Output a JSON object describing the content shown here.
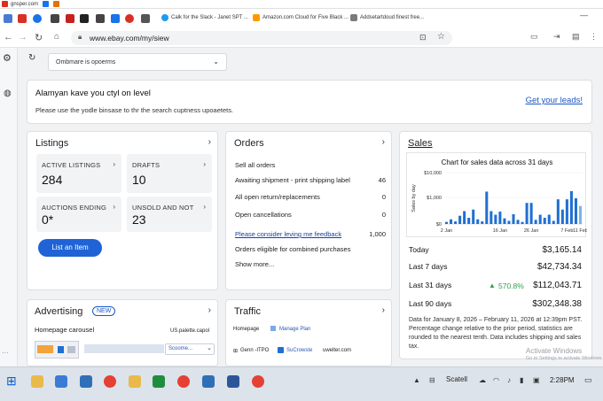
{
  "browser": {
    "bookmarks": [
      {
        "label": "gnsper.com",
        "color": "#d93025"
      },
      {
        "label": "",
        "color": "#1a73e8"
      },
      {
        "label": "",
        "color": "#e37400"
      }
    ],
    "tabs": [
      {
        "label": "Calk for the Slack - Janet SPT ...",
        "color": "#1d9bf0"
      },
      {
        "label": "Amazon.com Cloud for Five Black ...",
        "color": "#ff9900"
      },
      {
        "label": "Addsetartdoud finest free...",
        "color": "#7b7b7b"
      }
    ],
    "url": "www.ebay.com/my/siew"
  },
  "filter": {
    "selected": "Ombmare is opoerms"
  },
  "alert": {
    "title": "Alamyan kave you ctyl on level",
    "body": "Please use the yodle binsase to thr the search cuptness upoaetets.",
    "link": "Get your leads!"
  },
  "listings": {
    "title": "Listings",
    "tiles": [
      {
        "label": "ACTIVE LISTINGS",
        "value": "284"
      },
      {
        "label": "DRAFTS",
        "value": "10"
      },
      {
        "label": "AUCTIONS ENDING",
        "value": "0*"
      },
      {
        "label": "UNSOLD AND NOT",
        "value": "23"
      }
    ],
    "button": "List an Item"
  },
  "orders": {
    "title": "Orders",
    "rows": [
      {
        "label": "Sell all orders",
        "count": ""
      },
      {
        "label": "Awaiting shipment - print shipping label",
        "count": "46"
      },
      {
        "label": "All open return/replacements",
        "count": "0"
      },
      {
        "label": "Open cancellations",
        "count": "0"
      },
      {
        "label": "Please consider leving me feedback",
        "count": "1,000"
      },
      {
        "label": "Orders eligible for combined purchases",
        "count": ""
      }
    ],
    "show_more": "Show more..."
  },
  "sales": {
    "title": "Sales",
    "rows": [
      {
        "label": "Today",
        "value": "$3,165.14",
        "change": ""
      },
      {
        "label": "Last 7 days",
        "value": "$42,734.34",
        "change": ""
      },
      {
        "label": "Last 31 days",
        "value": "$112,043.71",
        "change": "570.8%"
      },
      {
        "label": "Last 90 days",
        "value": "$302,348.38",
        "change": ""
      }
    ],
    "footnote": "Data for January 8, 2026 – February 11, 2026 at 12:39pm PST. Percentage change relative to the prior period, statistics are rounded to the nearest tenth. Data includes shipping and sales tax.",
    "colors": {
      "bar": "#1f6fd1",
      "bar_light": "#7fb1ec",
      "up": "#2e9e4f"
    }
  },
  "chart_data": {
    "type": "bar",
    "title": "Chart for sales data across 31 days",
    "ylabel": "Sales by day",
    "ylim": [
      0,
      10000
    ],
    "yticks": [
      "$0",
      "$1,000",
      "$10,000"
    ],
    "xticks": [
      "2 Jan",
      "16 Jan",
      "26 Jan",
      "7 Feb",
      "11 Feb"
    ],
    "values": [
      400,
      900,
      500,
      1600,
      2500,
      1200,
      2800,
      900,
      500,
      6300,
      2500,
      1800,
      2400,
      1100,
      600,
      1900,
      800,
      400,
      4100,
      4100,
      800,
      1800,
      1200,
      1800,
      600,
      4800,
      2800,
      4800,
      6400,
      5000,
      3500
    ]
  },
  "advertising": {
    "title": "Advertising",
    "badge": "NEW",
    "sub": "Homepage carousel",
    "tag": "US.palette.capol",
    "select": "Scoome..."
  },
  "traffic": {
    "title": "Traffic",
    "sub": "Homepage",
    "plan": "Manage Plan",
    "a": "Genn -ITPO",
    "b": "SuCrowste",
    "c": "uwelter.com"
  },
  "watermark": {
    "line1": "Activate Windows",
    "line2": "Go to Settings to activate Windows."
  },
  "taskbar": {
    "search": "Scatell",
    "time": "2:28PM"
  }
}
